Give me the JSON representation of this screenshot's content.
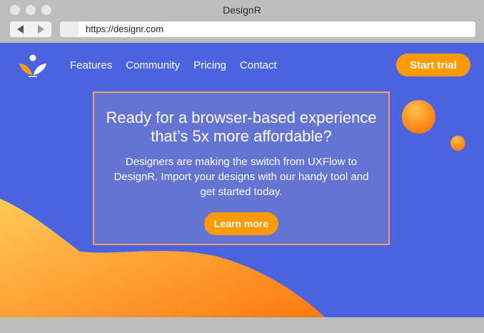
{
  "window": {
    "title": "DesignR"
  },
  "browser": {
    "url": "https://designr.com"
  },
  "nav": {
    "items": [
      {
        "label": "Features"
      },
      {
        "label": "Community"
      },
      {
        "label": "Pricing"
      },
      {
        "label": "Contact"
      }
    ],
    "cta_label": "Start trial"
  },
  "hero": {
    "heading": "Ready for a browser-based experience that’s 5x more affordable?",
    "body": "Designers are making the switch from UXFlow to DesignR. Import your designs with our handy tool and get started today.",
    "button_label": "Learn more"
  },
  "colors": {
    "background": "#4c63df",
    "accent": "#ff9a00",
    "hero_border": "#f0a05a"
  },
  "icons": {
    "logo": "leaf-person-logo-icon",
    "back": "back-arrow-icon",
    "forward": "forward-arrow-icon"
  }
}
